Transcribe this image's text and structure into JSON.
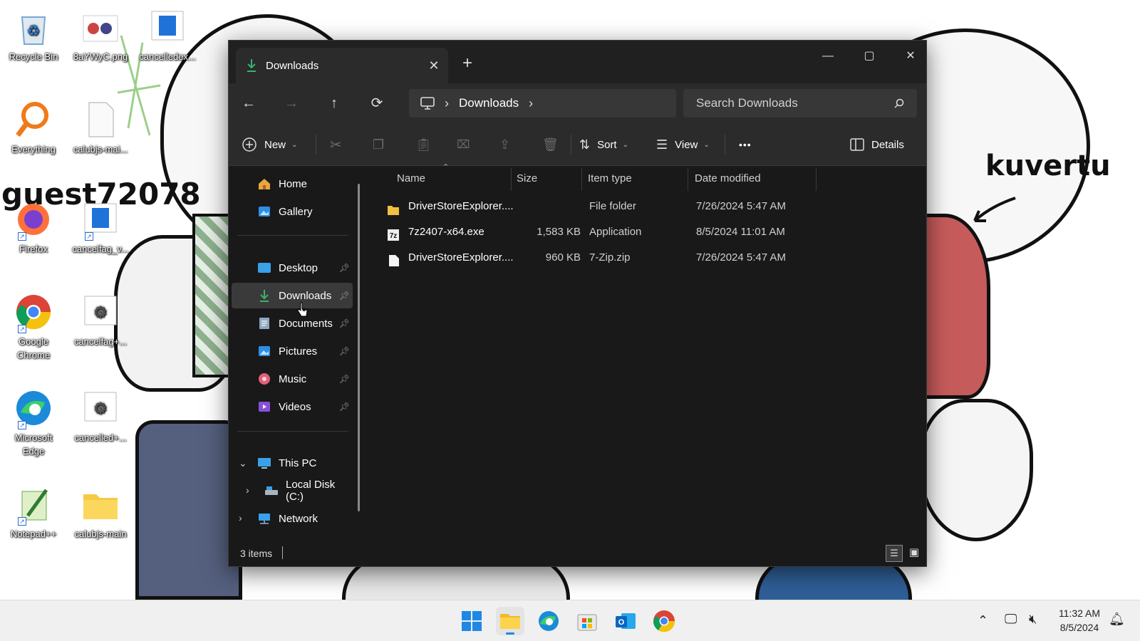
{
  "desktop": {
    "wallpaper_text": "guest72078",
    "wallpaper_word": "kuvertu",
    "icons": [
      {
        "label": "Recycle Bin"
      },
      {
        "label": "8aYWyC.png"
      },
      {
        "label": "cancelledex..."
      },
      {
        "label": "Everything"
      },
      {
        "label": "calubjs-mai..."
      },
      {
        "label": "Firefox"
      },
      {
        "label": "cancelfag_v..."
      },
      {
        "label": "Google Chrome"
      },
      {
        "label": "cancelfag+..."
      },
      {
        "label": "Microsoft Edge"
      },
      {
        "label": "cancelled+..."
      },
      {
        "label": "Notepad++"
      },
      {
        "label": "calubjs-main"
      }
    ]
  },
  "window": {
    "tab_title": "Downloads",
    "new_tab": "+",
    "address": {
      "crumb": "Downloads"
    },
    "search_placeholder": "Search Downloads",
    "commands": {
      "new": "New",
      "sort": "Sort",
      "view": "View",
      "more": "•••",
      "details": "Details"
    },
    "sidebar": {
      "home": "Home",
      "gallery": "Gallery",
      "desktop": "Desktop",
      "downloads": "Downloads",
      "documents": "Documents",
      "pictures": "Pictures",
      "music": "Music",
      "videos": "Videos",
      "this_pc": "This PC",
      "local_disk": "Local Disk (C:)",
      "network": "Network"
    },
    "columns": {
      "name": "Name",
      "size": "Size",
      "type": "Item type",
      "date": "Date modified"
    },
    "files": [
      {
        "name": "DriverStoreExplorer....",
        "size": "",
        "type": "File folder",
        "date": "7/26/2024 5:47 AM",
        "icon": "folder-icon"
      },
      {
        "name": "7z2407-x64.exe",
        "size": "1,583 KB",
        "type": "Application",
        "date": "8/5/2024 11:01 AM",
        "icon": "7zip-icon"
      },
      {
        "name": "DriverStoreExplorer....",
        "size": "960 KB",
        "type": "7-Zip.zip",
        "date": "7/26/2024 5:47 AM",
        "icon": "file-icon"
      }
    ],
    "status": {
      "count": "3 items"
    }
  },
  "taskbar": {
    "time": "11:32 AM",
    "date": "8/5/2024"
  }
}
